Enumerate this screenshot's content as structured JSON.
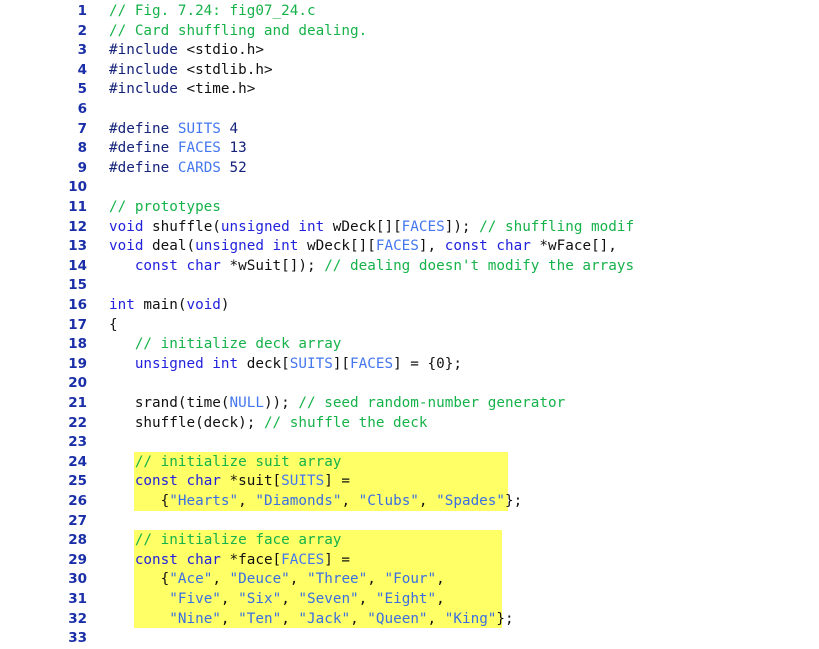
{
  "figure": {
    "caption_line": "// Fig. 7.24: fig07_24.c",
    "description_line": "// Card shuffling and dealing.",
    "figure_number": "7.24",
    "file_name": "fig07_24.c"
  },
  "colors": {
    "background": "#ffffff",
    "line_number": "#1a2ea8",
    "comment": "#16b24a",
    "keyword": "#2222dd",
    "constant": "#4477ee",
    "string": "#3b6fe0",
    "plain": "#111111",
    "highlight": "#ffff66"
  },
  "highlights": [
    {
      "name": "suit-array-highlight",
      "first_line": 24,
      "last_line": 26
    },
    {
      "name": "face-array-highlight",
      "first_line": 28,
      "last_line": 32
    }
  ],
  "lines": [
    {
      "n": "1",
      "highlight": false,
      "tokens": [
        {
          "t": "cmt",
          "s": "// Fig. 7.24: fig07_24.c"
        }
      ]
    },
    {
      "n": "2",
      "highlight": false,
      "tokens": [
        {
          "t": "cmt",
          "s": "// Card shuffling and dealing."
        }
      ]
    },
    {
      "n": "3",
      "highlight": false,
      "tokens": [
        {
          "t": "pp",
          "s": "#include"
        },
        {
          "t": "pln",
          "s": " <stdio.h>"
        }
      ]
    },
    {
      "n": "4",
      "highlight": false,
      "tokens": [
        {
          "t": "pp",
          "s": "#include"
        },
        {
          "t": "pln",
          "s": " <stdlib.h>"
        }
      ]
    },
    {
      "n": "5",
      "highlight": false,
      "tokens": [
        {
          "t": "pp",
          "s": "#include"
        },
        {
          "t": "pln",
          "s": " <time.h>"
        }
      ]
    },
    {
      "n": "6",
      "highlight": false,
      "tokens": []
    },
    {
      "n": "7",
      "highlight": false,
      "tokens": [
        {
          "t": "pp",
          "s": "#define "
        },
        {
          "t": "cst",
          "s": "SUITS"
        },
        {
          "t": "num",
          "s": " 4"
        }
      ]
    },
    {
      "n": "8",
      "highlight": false,
      "tokens": [
        {
          "t": "pp",
          "s": "#define "
        },
        {
          "t": "cst",
          "s": "FACES"
        },
        {
          "t": "num",
          "s": " 13"
        }
      ]
    },
    {
      "n": "9",
      "highlight": false,
      "tokens": [
        {
          "t": "pp",
          "s": "#define "
        },
        {
          "t": "cst",
          "s": "CARDS"
        },
        {
          "t": "num",
          "s": " 52"
        }
      ]
    },
    {
      "n": "10",
      "highlight": false,
      "tokens": []
    },
    {
      "n": "11",
      "highlight": false,
      "tokens": [
        {
          "t": "cmt",
          "s": "// prototypes"
        }
      ]
    },
    {
      "n": "12",
      "highlight": false,
      "tokens": [
        {
          "t": "kw",
          "s": "void"
        },
        {
          "t": "pln",
          "s": " shuffle("
        },
        {
          "t": "kw",
          "s": "unsigned int"
        },
        {
          "t": "pln",
          "s": " wDeck[]["
        },
        {
          "t": "cst",
          "s": "FACES"
        },
        {
          "t": "pln",
          "s": "]); "
        },
        {
          "t": "cmt",
          "s": "// shuffling modif"
        }
      ]
    },
    {
      "n": "13",
      "highlight": false,
      "tokens": [
        {
          "t": "kw",
          "s": "void"
        },
        {
          "t": "pln",
          "s": " deal("
        },
        {
          "t": "kw",
          "s": "unsigned int"
        },
        {
          "t": "pln",
          "s": " wDeck[]["
        },
        {
          "t": "cst",
          "s": "FACES"
        },
        {
          "t": "pln",
          "s": "], "
        },
        {
          "t": "kw",
          "s": "const char"
        },
        {
          "t": "pln",
          "s": " *wFace[],"
        }
      ]
    },
    {
      "n": "14",
      "highlight": false,
      "tokens": [
        {
          "t": "pln",
          "s": "   "
        },
        {
          "t": "kw",
          "s": "const char"
        },
        {
          "t": "pln",
          "s": " *wSuit[]); "
        },
        {
          "t": "cmt",
          "s": "// dealing doesn't modify the arrays"
        }
      ]
    },
    {
      "n": "15",
      "highlight": false,
      "tokens": []
    },
    {
      "n": "16",
      "highlight": false,
      "tokens": [
        {
          "t": "kw",
          "s": "int"
        },
        {
          "t": "pln",
          "s": " main("
        },
        {
          "t": "kw",
          "s": "void"
        },
        {
          "t": "pln",
          "s": ")"
        }
      ]
    },
    {
      "n": "17",
      "highlight": false,
      "tokens": [
        {
          "t": "pln",
          "s": "{"
        }
      ]
    },
    {
      "n": "18",
      "highlight": false,
      "tokens": [
        {
          "t": "pln",
          "s": "   "
        },
        {
          "t": "cmt",
          "s": "// initialize deck array"
        }
      ]
    },
    {
      "n": "19",
      "highlight": false,
      "tokens": [
        {
          "t": "pln",
          "s": "   "
        },
        {
          "t": "kw",
          "s": "unsigned int"
        },
        {
          "t": "pln",
          "s": " deck["
        },
        {
          "t": "cst",
          "s": "SUITS"
        },
        {
          "t": "pln",
          "s": "]["
        },
        {
          "t": "cst",
          "s": "FACES"
        },
        {
          "t": "pln",
          "s": "] = {0};"
        }
      ]
    },
    {
      "n": "20",
      "highlight": false,
      "tokens": []
    },
    {
      "n": "21",
      "highlight": false,
      "tokens": [
        {
          "t": "pln",
          "s": "   srand(time("
        },
        {
          "t": "cst",
          "s": "NULL"
        },
        {
          "t": "pln",
          "s": ")); "
        },
        {
          "t": "cmt",
          "s": "// seed random-number generator"
        }
      ]
    },
    {
      "n": "22",
      "highlight": false,
      "tokens": [
        {
          "t": "pln",
          "s": "   shuffle(deck); "
        },
        {
          "t": "cmt",
          "s": "// shuffle the deck"
        }
      ]
    },
    {
      "n": "23",
      "highlight": false,
      "tokens": []
    },
    {
      "n": "24",
      "highlight": true,
      "tokens": [
        {
          "t": "pln",
          "s": "   "
        },
        {
          "t": "cmt",
          "s": "// initialize suit array"
        }
      ]
    },
    {
      "n": "25",
      "highlight": true,
      "tokens": [
        {
          "t": "pln",
          "s": "   "
        },
        {
          "t": "kw",
          "s": "const char"
        },
        {
          "t": "pln",
          "s": " *suit["
        },
        {
          "t": "cst",
          "s": "SUITS"
        },
        {
          "t": "pln",
          "s": "] ="
        }
      ]
    },
    {
      "n": "26",
      "highlight": true,
      "tokens": [
        {
          "t": "pln",
          "s": "      {"
        },
        {
          "t": "str",
          "s": "\"Hearts\""
        },
        {
          "t": "pln",
          "s": ", "
        },
        {
          "t": "str",
          "s": "\"Diamonds\""
        },
        {
          "t": "pln",
          "s": ", "
        },
        {
          "t": "str",
          "s": "\"Clubs\""
        },
        {
          "t": "pln",
          "s": ", "
        },
        {
          "t": "str",
          "s": "\"Spades\""
        },
        {
          "t": "pln",
          "s": "};"
        }
      ]
    },
    {
      "n": "27",
      "highlight": false,
      "tokens": []
    },
    {
      "n": "28",
      "highlight": true,
      "tokens": [
        {
          "t": "pln",
          "s": "   "
        },
        {
          "t": "cmt",
          "s": "// initialize face array"
        }
      ]
    },
    {
      "n": "29",
      "highlight": true,
      "tokens": [
        {
          "t": "pln",
          "s": "   "
        },
        {
          "t": "kw",
          "s": "const char"
        },
        {
          "t": "pln",
          "s": " *face["
        },
        {
          "t": "cst",
          "s": "FACES"
        },
        {
          "t": "pln",
          "s": "] ="
        }
      ]
    },
    {
      "n": "30",
      "highlight": true,
      "tokens": [
        {
          "t": "pln",
          "s": "      {"
        },
        {
          "t": "str",
          "s": "\"Ace\""
        },
        {
          "t": "pln",
          "s": ", "
        },
        {
          "t": "str",
          "s": "\"Deuce\""
        },
        {
          "t": "pln",
          "s": ", "
        },
        {
          "t": "str",
          "s": "\"Three\""
        },
        {
          "t": "pln",
          "s": ", "
        },
        {
          "t": "str",
          "s": "\"Four\""
        },
        {
          "t": "pln",
          "s": ","
        }
      ]
    },
    {
      "n": "31",
      "highlight": true,
      "tokens": [
        {
          "t": "pln",
          "s": "       "
        },
        {
          "t": "str",
          "s": "\"Five\""
        },
        {
          "t": "pln",
          "s": ", "
        },
        {
          "t": "str",
          "s": "\"Six\""
        },
        {
          "t": "pln",
          "s": ", "
        },
        {
          "t": "str",
          "s": "\"Seven\""
        },
        {
          "t": "pln",
          "s": ", "
        },
        {
          "t": "str",
          "s": "\"Eight\""
        },
        {
          "t": "pln",
          "s": ","
        }
      ]
    },
    {
      "n": "32",
      "highlight": true,
      "tokens": [
        {
          "t": "pln",
          "s": "       "
        },
        {
          "t": "str",
          "s": "\"Nine\""
        },
        {
          "t": "pln",
          "s": ", "
        },
        {
          "t": "str",
          "s": "\"Ten\""
        },
        {
          "t": "pln",
          "s": ", "
        },
        {
          "t": "str",
          "s": "\"Jack\""
        },
        {
          "t": "pln",
          "s": ", "
        },
        {
          "t": "str",
          "s": "\"Queen\""
        },
        {
          "t": "pln",
          "s": ", "
        },
        {
          "t": "str",
          "s": "\"King\""
        },
        {
          "t": "pln",
          "s": "};"
        }
      ]
    },
    {
      "n": "33",
      "highlight": false,
      "tokens": []
    }
  ]
}
